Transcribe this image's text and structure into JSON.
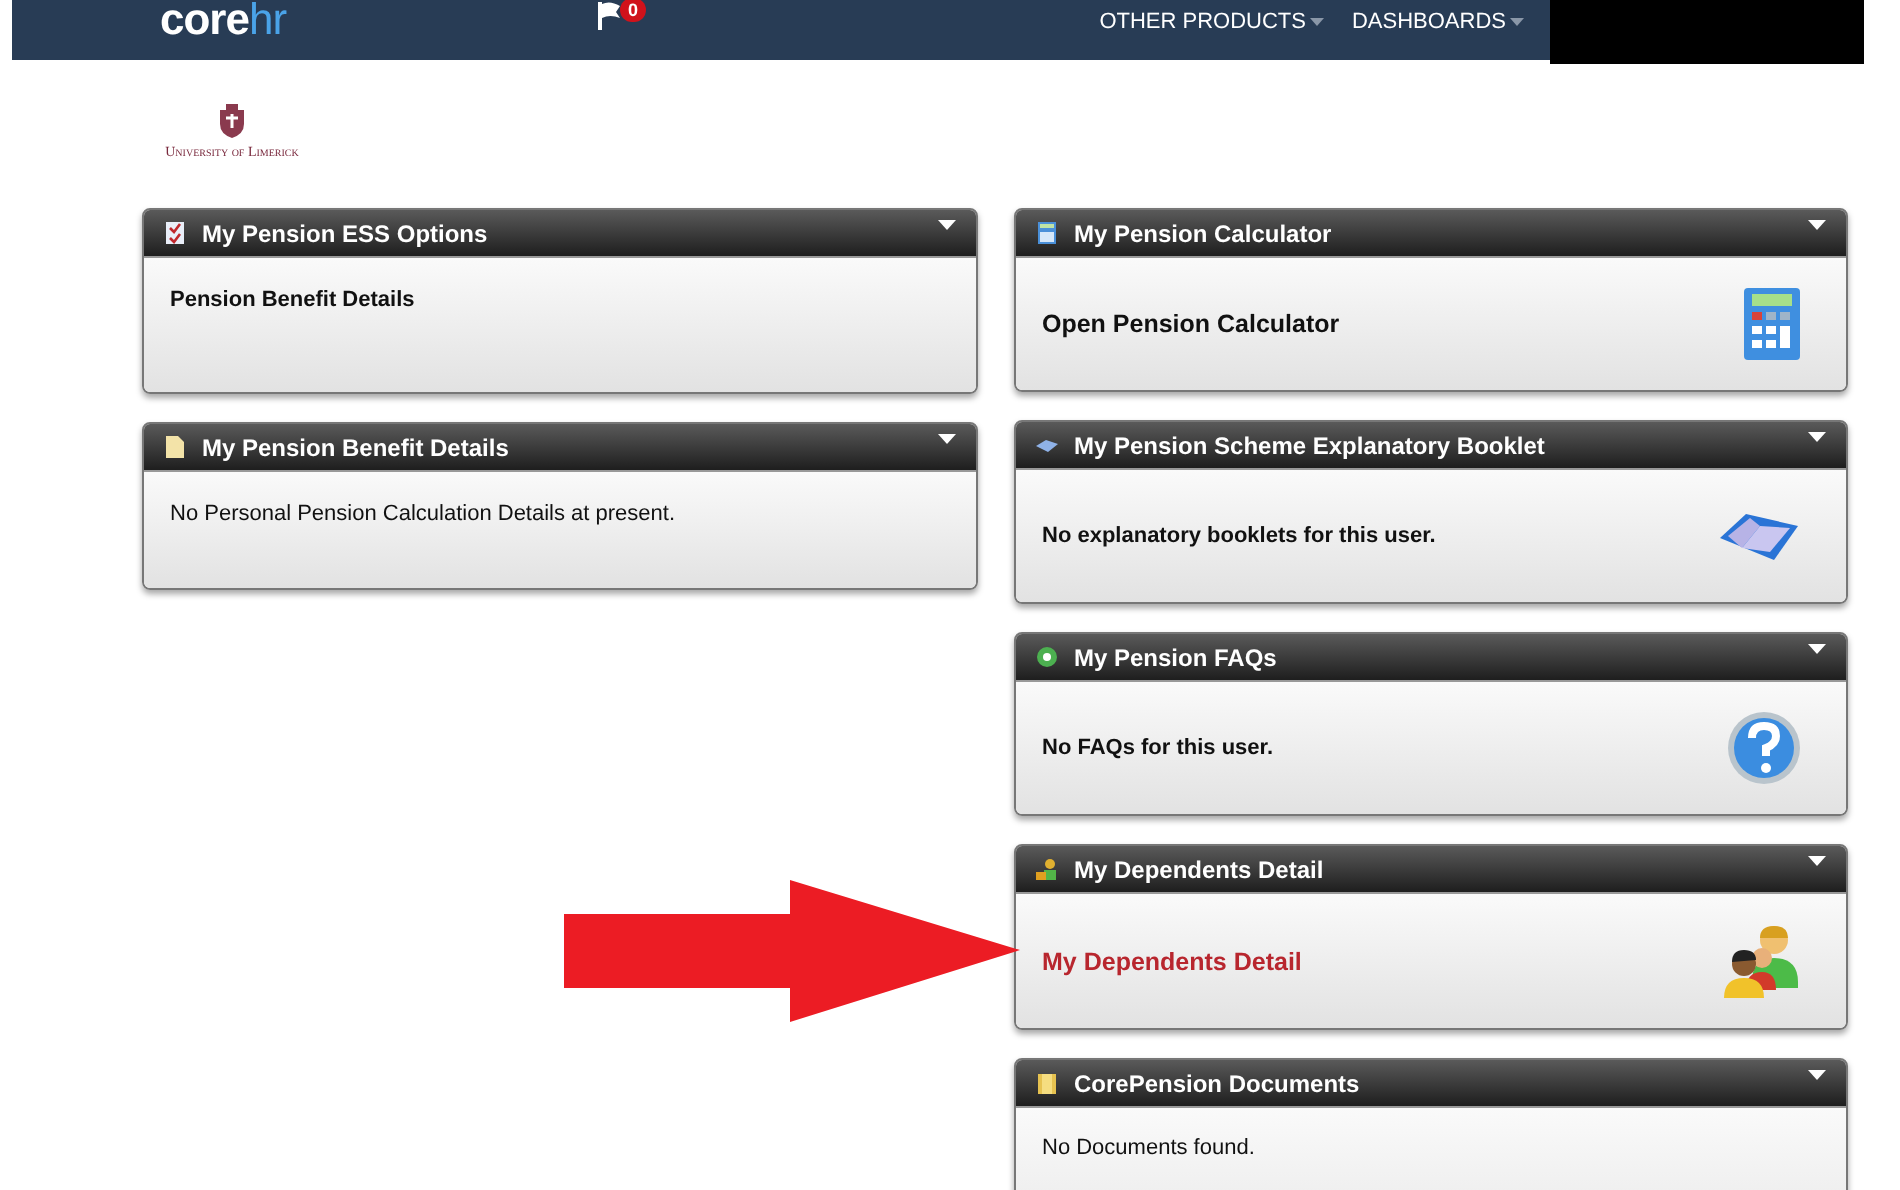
{
  "header": {
    "logo": {
      "first": "core",
      "second": "hr"
    },
    "notifications": {
      "count": "0"
    },
    "nav": [
      {
        "label": "OTHER PRODUCTS"
      },
      {
        "label": "DASHBOARDS"
      }
    ]
  },
  "institution": {
    "name": "University of Limerick"
  },
  "columns": [
    [
      {
        "title": "My Pension ESS Options",
        "kind": "link",
        "text": "Pension Benefit Details"
      },
      {
        "title": "My Pension Benefit Details",
        "kind": "text",
        "text": "No Personal Pension Calculation Details at present."
      }
    ],
    [
      {
        "title": "My Pension Calculator",
        "kind": "action",
        "text": "Open Pension Calculator"
      },
      {
        "title": "My Pension Scheme Explanatory Booklet",
        "kind": "link",
        "text": "No explanatory booklets for this user."
      },
      {
        "title": "My Pension FAQs",
        "kind": "link",
        "text": "No FAQs for this user."
      },
      {
        "title": "My Dependents Detail",
        "kind": "highlight",
        "text": "My Dependents Detail"
      },
      {
        "title": "CorePension Documents",
        "kind": "text",
        "text": "No Documents found."
      }
    ]
  ]
}
